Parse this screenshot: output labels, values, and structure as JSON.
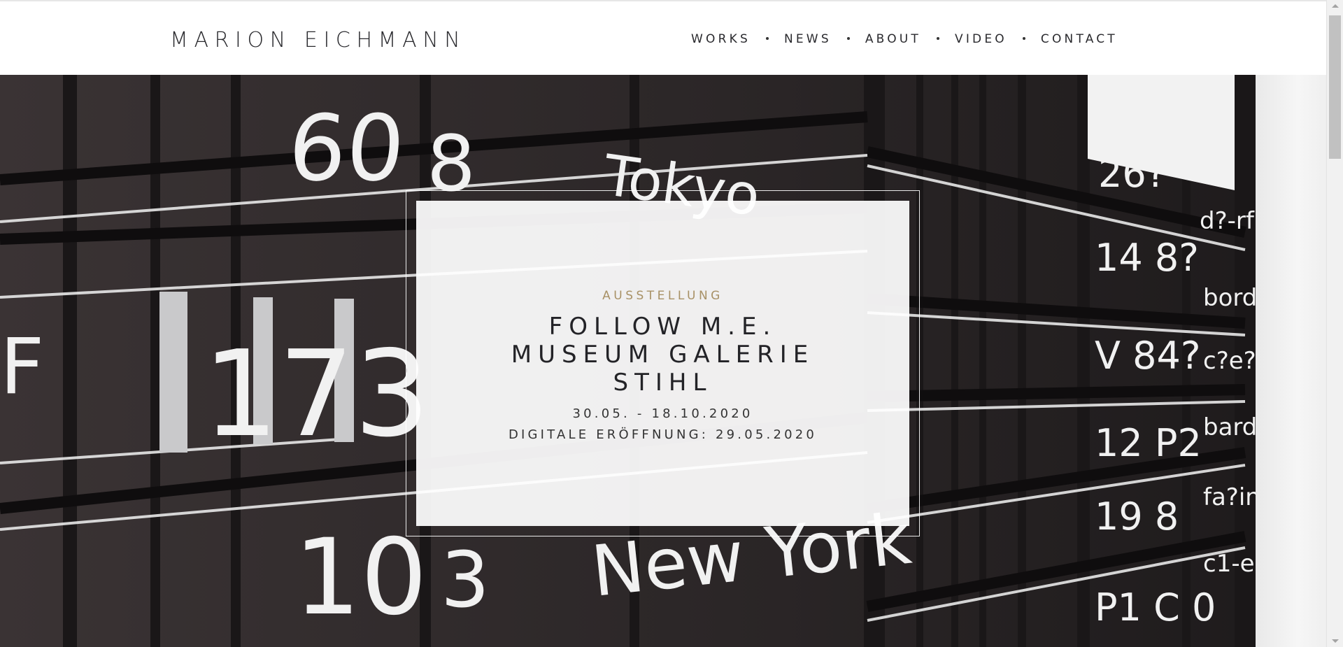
{
  "site": {
    "logo": "MARION EICHMANN"
  },
  "nav": {
    "items": [
      {
        "label": "WORKS"
      },
      {
        "label": "NEWS"
      },
      {
        "label": "ABOUT"
      },
      {
        "label": "VIDEO"
      },
      {
        "label": "CONTACT"
      }
    ]
  },
  "hero": {
    "kicker": "AUSSTELLUNG",
    "title_lines": [
      "FOLLOW M.E.",
      "MUSEUM GALERIE",
      "STIHL"
    ],
    "dates": "30.05. - 18.10.2020",
    "opening": "DIGITALE ERÖFFNUNG: 29.05.2020"
  },
  "colors": {
    "kicker": "#a89166",
    "text": "#232327",
    "board": "#2a2526"
  }
}
